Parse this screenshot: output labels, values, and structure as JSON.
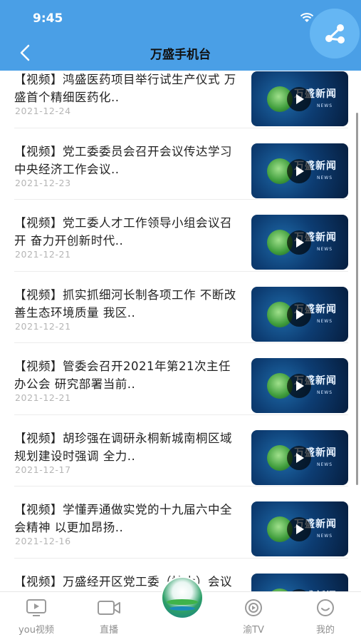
{
  "status": {
    "time": "9:45"
  },
  "header": {
    "title": "万盛手机台"
  },
  "news": [
    {
      "title": "【视频】鸿盛医药项目举行试生产仪式 万盛首个精细医药化..",
      "date": "2021-12-24"
    },
    {
      "title": "【视频】党工委委员会召开会议传达学习中央经济工作会议..",
      "date": "2021-12-23"
    },
    {
      "title": "【视频】党工委人才工作领导小组会议召开 奋力开创新时代..",
      "date": "2021-12-21"
    },
    {
      "title": "【视频】抓实抓细河长制各项工作 不断改善生态环境质量 我区..",
      "date": "2021-12-21"
    },
    {
      "title": "【视频】管委会召开2021年第21次主任办公会 研究部署当前..",
      "date": "2021-12-21"
    },
    {
      "title": "【视频】胡珍强在调研永桐新城南桐区域规划建设时强调 全力..",
      "date": "2021-12-17"
    },
    {
      "title": "【视频】学懂弄通做实党的十九届六中全会精神 以更加昂扬..",
      "date": "2021-12-16"
    },
    {
      "title": "【视频】万盛经开区党工委（扩大）会议召开 深入学习贯彻..",
      "date": ""
    }
  ],
  "thumbnail": {
    "brand_cn": "万盛新闻",
    "brand_en": "NEWS"
  },
  "tabbar": {
    "items": [
      {
        "label": "you视频",
        "icon": "tv-play-icon"
      },
      {
        "label": "直播",
        "icon": "video-camera-icon"
      },
      {
        "label": "",
        "icon": "center-logo-icon"
      },
      {
        "label": "渝TV",
        "icon": "yu-tv-icon"
      },
      {
        "label": "我的",
        "icon": "smile-icon"
      }
    ]
  },
  "colors": {
    "header": "#4a9fe6",
    "share_badge": "#65b6f3",
    "tab_label": "#8f8f8f",
    "date": "#b5b5b5"
  }
}
